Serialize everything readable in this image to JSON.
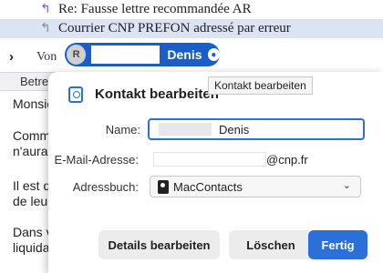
{
  "thread": {
    "rows": [
      {
        "subject": "Re: Fausse lettre recommandée AR"
      },
      {
        "subject": "Courrier CNP PREFON adressé par erreur"
      }
    ]
  },
  "header": {
    "from_label": "Von",
    "avatar_initial": "R",
    "sender_name": "Denis",
    "subject_label": "Betre"
  },
  "message_body": [
    "Monsie",
    "Comme",
    "n'aurait",
    "Il est d",
    "de leurs",
    "Dans vo",
    "liquidat"
  ],
  "tooltip": "Kontakt bearbeiten",
  "dialog": {
    "title": "Kontakt bearbeiten",
    "fields": {
      "name_label": "Name:",
      "name_value": "Denis",
      "email_label": "E-Mail-Adresse:",
      "email_value": "@cnp.fr",
      "addressbook_label": "Adressbuch:",
      "addressbook_value": "MacContacts"
    },
    "buttons": {
      "details": "Details bearbeiten",
      "delete": "Löschen",
      "done": "Fertig"
    }
  },
  "colors": {
    "accent": "#2b6fd9",
    "selected_row": "#dbe3f7"
  }
}
